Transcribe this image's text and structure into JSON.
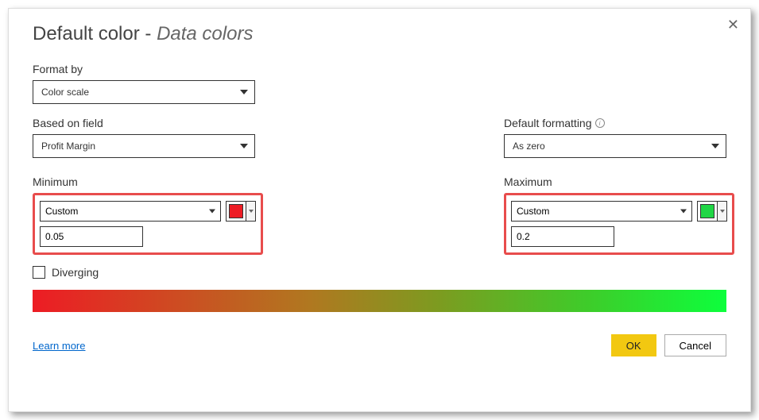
{
  "title_main": "Default color - ",
  "title_italic": "Data colors",
  "format_by_label": "Format by",
  "format_by_value": "Color scale",
  "based_on_label": "Based on field",
  "based_on_value": "Profit Margin",
  "default_fmt_label": "Default formatting",
  "default_fmt_value": "As zero",
  "minimum_label": "Minimum",
  "minimum_mode": "Custom",
  "minimum_value": "0.05",
  "minimum_color": "#ed1c24",
  "maximum_label": "Maximum",
  "maximum_mode": "Custom",
  "maximum_value": "0.2",
  "maximum_color": "#20d645",
  "diverging_label": "Diverging",
  "learn_more": "Learn more",
  "ok_label": "OK",
  "cancel_label": "Cancel"
}
